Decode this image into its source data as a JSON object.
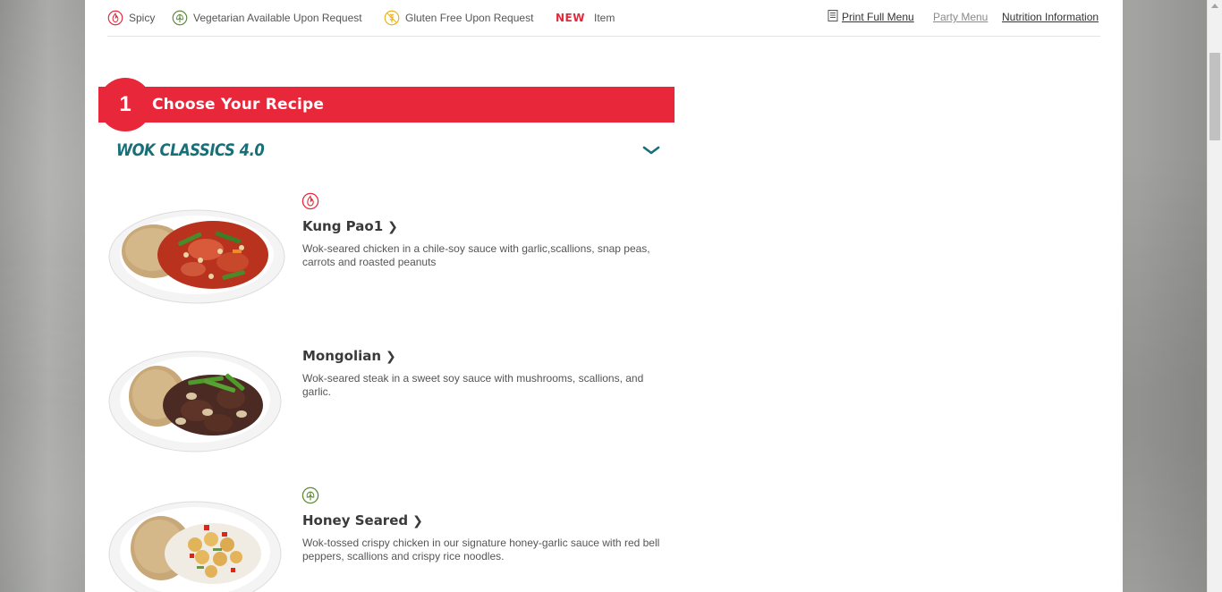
{
  "legend": {
    "items": [
      {
        "label": "Spicy",
        "icon": "spicy-icon"
      },
      {
        "label": "Vegetarian Available Upon Request",
        "icon": "vegetarian-icon"
      },
      {
        "label": "Gluten Free Upon Request",
        "icon": "gluten-free-icon"
      }
    ],
    "new_badge": "NEW",
    "new_item_label": "Item"
  },
  "links": {
    "print_full_menu": "Print Full Menu",
    "party_menu": "Party Menu",
    "nutrition_information": "Nutrition Information"
  },
  "step": {
    "number": "1",
    "title": "Choose Your Recipe"
  },
  "category": {
    "title": "WOK CLASSICS 4.0"
  },
  "menu_items": [
    {
      "name": "Kung Pao",
      "footnote": "1",
      "badge": "spicy-icon",
      "description": "Wok-seared chicken in a chile-soy sauce with garlic,scallions, snap peas, carrots and roasted peanuts"
    },
    {
      "name": "Mongolian",
      "footnote": "",
      "badge": "",
      "description": "Wok-seared steak in a sweet soy sauce with mushrooms, scallions, and garlic."
    },
    {
      "name": "Honey Seared",
      "footnote": "",
      "badge": "vegetarian-icon",
      "description": "Wok-tossed crispy chicken in our signature honey-garlic sauce with red bell peppers, scallions and crispy rice noodles."
    }
  ],
  "colors": {
    "brand_red": "#e8283a",
    "teal": "#176f78",
    "vegetarian_green": "#5e8a3a",
    "gluten_yellow": "#e8b321"
  }
}
